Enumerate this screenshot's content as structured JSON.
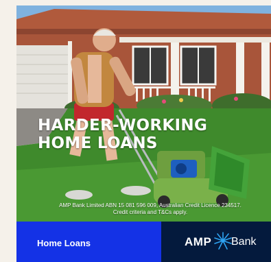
{
  "ad": {
    "headline_line1": "HARDER-WORKING",
    "headline_line2": "HOME LOANS",
    "disclaimer_line1": "AMP Bank Limited ABN 15 081 596 009, Australian Credit Licence 234517.",
    "disclaimer_line2": "Credit criteria and T&Cs apply.",
    "cta_label": "Home Loans",
    "brand_amp": "AMP",
    "brand_bank": "Bank",
    "logo_icon": "starburst-icon"
  },
  "colors": {
    "cta_blue": "#1432e6",
    "brand_navy": "#041a3d",
    "logo_blue": "#2ea3f2",
    "text": "#ffffff"
  }
}
